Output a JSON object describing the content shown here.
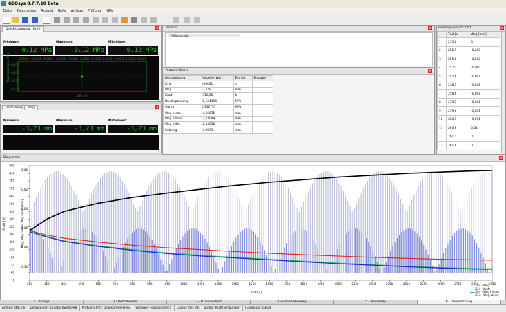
{
  "app": {
    "title": "GEOsys 8.7.7.10 Beta"
  },
  "menu": [
    "Datei",
    "Bearbeiten",
    "Ansicht",
    "Rolle",
    "Anlage",
    "Prüfung",
    "Hilfe"
  ],
  "pressure_panel": {
    "tabs": [
      "Druckspannung",
      "Kraft"
    ],
    "labels": [
      "Minimum",
      "Maximum",
      "Mittelwert"
    ],
    "values": [
      "-0,12 MPa",
      "-0,12 MPa",
      "-0,12 MPa"
    ],
    "mini_chart": {
      "ylabel": "Druckspannung [MPa]",
      "xlabel": "Zeit [s]",
      "x_ticks": [
        "-0.0026",
        "-0.0024",
        "-0.0022",
        "-0.0020",
        "-0.0014",
        "0.0000",
        "0.0014",
        "0.0020",
        "0.0022",
        "0.0024",
        "0.0026"
      ],
      "y_ticks": [
        "-0.114",
        "-0.116",
        "-0.120",
        "-0.124"
      ]
    }
  },
  "deformation_panel": {
    "tabs": [
      "Verformung",
      "Weg"
    ],
    "labels": [
      "Minimum",
      "Maximum",
      "Mittelwert"
    ],
    "values": [
      "-3,23 mm",
      "-3,23 mm",
      "-3,23 mm"
    ]
  },
  "verlauf_panel": {
    "title": "Verlauf",
    "item": "Prüfvorschrift"
  },
  "current_values": {
    "title": "Aktuelle Werte",
    "headers": [
      "Beschreibung",
      "Aktueller Wert",
      "Einheit",
      "Eingabe"
    ],
    "rows": [
      [
        "Zeit",
        "298551",
        "s",
        ""
      ],
      [
        "Weg",
        "-3,229",
        "mm",
        ""
      ],
      [
        "Kraft",
        "-310,55",
        "N",
        ""
      ],
      [
        "Druckspannung",
        "-0,124304",
        "MPa",
        ""
      ],
      [
        "sigma",
        "0,352797",
        "MPa",
        ""
      ],
      [
        "Weg vorne",
        "-4,56635",
        "mm",
        ""
      ],
      [
        "Weg hinten",
        "-3,23089",
        "mm",
        ""
      ],
      [
        "Weg mitte",
        "-2,34816",
        "mm",
        ""
      ],
      [
        "Setzung",
        "-4,9091",
        "mm",
        ""
      ]
    ]
  },
  "table_panel": {
    "title": "Bindung versuch 2.txt",
    "headers": [
      "",
      "Zeit [s]",
      "Weg [mm]"
    ],
    "rows": [
      [
        "1",
        "255,6",
        "0"
      ],
      [
        "2",
        "256,1",
        "-0,002"
      ],
      [
        "3",
        "256,6",
        "-0,002"
      ],
      [
        "4",
        "257,1",
        "-0,000"
      ],
      [
        "5",
        "257,6",
        "-0,001"
      ],
      [
        "6",
        "258,1",
        "-0,002"
      ],
      [
        "7",
        "258,6",
        "-0,001"
      ],
      [
        "8",
        "259,1",
        "-0,002"
      ],
      [
        "9",
        "259,6",
        "-0,001"
      ],
      [
        "10",
        "260,1",
        "-0,001"
      ],
      [
        "11",
        "260,6",
        "0,01"
      ],
      [
        "12",
        "261,1",
        "0"
      ],
      [
        "13",
        "261,6",
        "0"
      ]
    ]
  },
  "diagram": {
    "title": "Diagramm",
    "xlabel": "Zeit [s]",
    "ylabel_left": "Kraft [N]",
    "ylabel_mid": "Weg, Weg hinten, Weg vorne [mm]",
    "x_ticks": [
      "250",
      "350",
      "450",
      "550",
      "650",
      "750",
      "850",
      "950",
      "1050",
      "1150",
      "1250",
      "1350",
      "1450",
      "1550",
      "1650",
      "1750",
      "1850",
      "1950",
      "2050",
      "2150",
      "2250",
      "2350",
      "2450",
      "2550",
      "2650",
      "2750",
      "2850",
      "2950"
    ],
    "y_left_ticks": [
      "900",
      "840",
      "780",
      "720",
      "660",
      "600",
      "540",
      "480",
      "420",
      "360",
      "300",
      "240",
      "180",
      "120",
      "60",
      "0"
    ],
    "y_mid_ticks": [
      "0.00",
      "-0.02",
      "-0.04",
      "-0.06",
      "-0.08",
      "-0.10"
    ],
    "legend": [
      "Zeit - Weg",
      "Zeit - Kraft",
      "Zeit - Weg hinten",
      "Zeit - Weg vorne"
    ],
    "colors": {
      "weg": "#000000",
      "kraft": "#e02020",
      "weg_hinten": "#20c060",
      "weg_vorne": "#2020d0"
    }
  },
  "chart_data": {
    "type": "line",
    "xlabel": "Zeit [s]",
    "ylabel": "Kraft [N]",
    "xlim": [
      250,
      2950
    ],
    "ylim": [
      0,
      900
    ],
    "series": [
      {
        "name": "Zeit - Weg",
        "x": [
          250,
          350,
          450,
          650,
          850,
          1050,
          1250,
          1450,
          1650,
          1850,
          2050,
          2250,
          2450,
          2650,
          2850,
          2950
        ],
        "y": [
          390,
          480,
          540,
          605,
          650,
          685,
          715,
          745,
          770,
          790,
          810,
          825,
          840,
          850,
          860,
          862
        ]
      },
      {
        "name": "Zeit - Kraft",
        "x": [
          250,
          350,
          450,
          650,
          850,
          1050,
          1250,
          1450,
          1650,
          1850,
          2050,
          2250,
          2450,
          2650,
          2850,
          2950
        ],
        "y": [
          390,
          355,
          330,
          300,
          275,
          255,
          240,
          225,
          212,
          200,
          190,
          180,
          172,
          165,
          160,
          158
        ]
      },
      {
        "name": "Zeit - Weg hinten",
        "x": [
          250,
          350,
          450,
          650,
          850,
          1050,
          1250,
          1450,
          1650,
          1850,
          2050,
          2250,
          2450,
          2650,
          2850,
          2950
        ],
        "y": [
          385,
          345,
          310,
          270,
          240,
          215,
          195,
          180,
          165,
          150,
          135,
          122,
          110,
          100,
          92,
          90
        ]
      },
      {
        "name": "Zeit - Weg vorne",
        "x": [
          250,
          350,
          450,
          650,
          850,
          1050,
          1250,
          1450,
          1650,
          1850,
          2050,
          2250,
          2450,
          2650,
          2850,
          2950
        ],
        "y": [
          380,
          340,
          305,
          265,
          235,
          210,
          190,
          175,
          160,
          145,
          130,
          118,
          106,
          96,
          88,
          86
        ]
      }
    ]
  },
  "bottom_tabs": [
    "1 - Anlage",
    "2 - Definitionen",
    "3 - Prüfvorschrift",
    "4 - Handbedienung",
    "5 - Protokolle",
    "6 - Überwachung"
  ],
  "statusbar": [
    "Anlage: stat_dn",
    "Definitionen: Druckschwell DeN",
    "Prüfvorschrift: Druckschwell Proc",
    "Vorlagen: <unbenannt>",
    "Layout: mix_dn",
    "Status: Nicht verbunden",
    "S=Simulat: GEOil"
  ]
}
